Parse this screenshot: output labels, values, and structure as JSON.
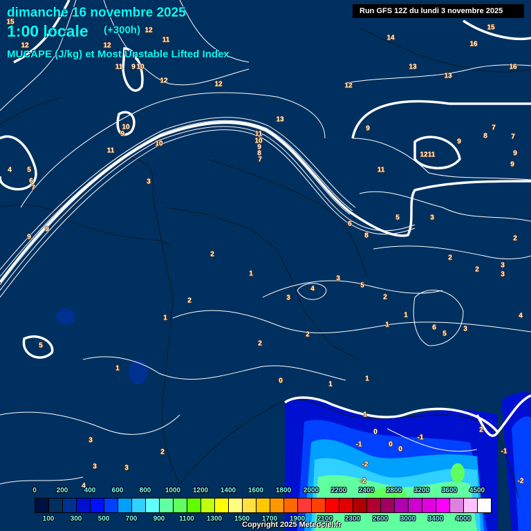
{
  "header": {
    "date": "dimanche 16 novembre 2025",
    "time": "1:00 locale",
    "lead": "(+300h)",
    "parameter": "MUCAPE (J/kg) et Most Unstable Lifted Index",
    "run": "Run GFS 12Z du lundi 3 novembre 2025"
  },
  "colorbar": {
    "thresholds": [
      0,
      100,
      200,
      300,
      400,
      500,
      600,
      700,
      800,
      900,
      1000,
      1100,
      1200,
      1300,
      1400,
      1500,
      1600,
      1700,
      1800,
      1900,
      2000,
      2100,
      2200,
      2300,
      2400,
      2600,
      2800,
      3000,
      3200,
      3400,
      3600,
      4000,
      4500
    ],
    "labels": [
      "0",
      "100",
      "200",
      "300",
      "400",
      "500",
      "600",
      "700",
      "800",
      "900",
      "1000",
      "1100",
      "1200",
      "1300",
      "1400",
      "1500",
      "1600",
      "1700",
      "1800",
      "1900",
      "2000",
      "2100",
      "2200",
      "2300",
      "2400",
      "2600",
      "2800",
      "3000",
      "3200",
      "3400",
      "3600",
      "4000",
      "4500"
    ],
    "colors": [
      "#001040",
      "#003060",
      "#003090",
      "#0010d0",
      "#0010ff",
      "#0040ff",
      "#00a0ff",
      "#30d0ff",
      "#60ffff",
      "#60ffa0",
      "#60ff60",
      "#60ff00",
      "#c0ff10",
      "#ffff00",
      "#ffff80",
      "#ffe040",
      "#ffc800",
      "#ff9800",
      "#ff6800",
      "#ff3838",
      "#ff4000",
      "#ff0000",
      "#e00000",
      "#b00000",
      "#b00030",
      "#a00060",
      "#b000b0",
      "#d000d0",
      "#e000e0",
      "#ff00ff",
      "#e080e0",
      "#ffc0ff",
      "#ffffff"
    ]
  },
  "lifted_index_labels": [
    "15",
    "12",
    "12",
    "12",
    "11",
    "11",
    "9",
    "10",
    "12",
    "12",
    "10",
    "9",
    "11",
    "10",
    "4",
    "5",
    "6",
    "7",
    "9",
    "9",
    "3",
    "13",
    "14",
    "13",
    "13",
    "15",
    "16",
    "16",
    "12",
    "9",
    "12",
    "11",
    "9",
    "7",
    "8",
    "7",
    "9",
    "9",
    "11",
    "11",
    "10",
    "9",
    "8",
    "7",
    "6",
    "8",
    "5",
    "3",
    "2",
    "2",
    "2",
    "3",
    "3",
    "2",
    "1",
    "3",
    "4",
    "5",
    "3",
    "2",
    "1",
    "2",
    "1",
    "1",
    "6",
    "5",
    "3",
    "4",
    "2",
    "2",
    "5",
    "1",
    "0",
    "1",
    "1",
    "1",
    "0",
    "-1",
    "0",
    "0",
    "-1",
    "2",
    "-1",
    "-2",
    "-2",
    "-2",
    "3",
    "2",
    "3",
    "3",
    "4"
  ],
  "copyright": "Copyright 2025 Meteociel.fr"
}
